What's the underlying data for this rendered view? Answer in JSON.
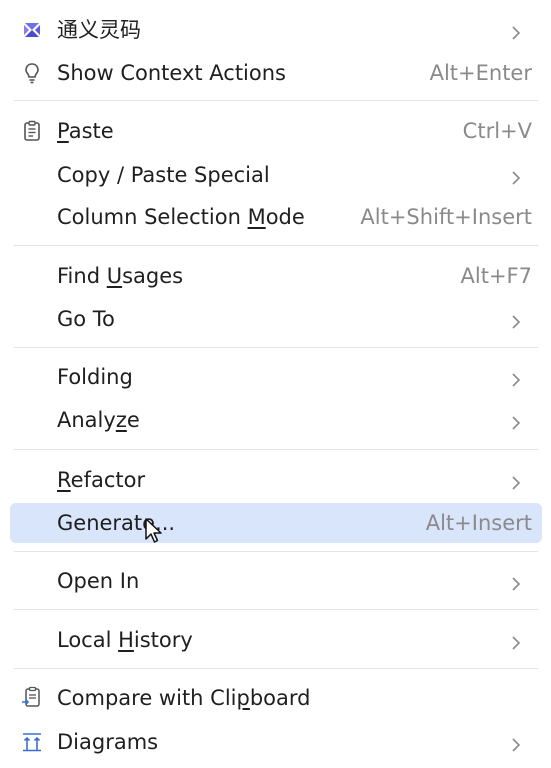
{
  "menu": {
    "items": [
      {
        "label": "通义灵码",
        "shortcut": "",
        "submenu": true,
        "icon": "tongyi-icon"
      },
      {
        "label": "Show Context Actions",
        "shortcut": "Alt+Enter",
        "submenu": false,
        "icon": "bulb-icon"
      },
      {
        "label_pre": "",
        "label_mn": "P",
        "label_post": "aste",
        "shortcut": "Ctrl+V",
        "submenu": false,
        "icon": "clipboard-icon"
      },
      {
        "label": "Copy / Paste Special",
        "shortcut": "",
        "submenu": true
      },
      {
        "label_pre": "Column Selection ",
        "label_mn": "M",
        "label_post": "ode",
        "shortcut": "Alt+Shift+Insert",
        "submenu": false
      },
      {
        "label_pre": "Find ",
        "label_mn": "U",
        "label_post": "sages",
        "shortcut": "Alt+F7",
        "submenu": false
      },
      {
        "label": "Go To",
        "shortcut": "",
        "submenu": true
      },
      {
        "label": "Folding",
        "shortcut": "",
        "submenu": true
      },
      {
        "label_pre": "Analy",
        "label_mn": "z",
        "label_post": "e",
        "shortcut": "",
        "submenu": true
      },
      {
        "label_pre": "",
        "label_mn": "R",
        "label_post": "efactor",
        "shortcut": "",
        "submenu": true
      },
      {
        "label": "Generate...",
        "shortcut": "Alt+Insert",
        "submenu": false,
        "highlighted": true
      },
      {
        "label": "Open In",
        "shortcut": "",
        "submenu": true
      },
      {
        "label_pre": "Local ",
        "label_mn": "H",
        "label_post": "istory",
        "shortcut": "",
        "submenu": true
      },
      {
        "label_pre": "Compare with Cli",
        "label_mn": "p",
        "label_post": "board",
        "shortcut": "",
        "submenu": false,
        "icon": "compare-clipboard-icon"
      },
      {
        "label": "Diagrams",
        "shortcut": "",
        "submenu": true,
        "icon": "diagram-icon"
      }
    ]
  },
  "colors": {
    "highlight": "#d9e5fb",
    "text": "#1f1f1f",
    "shortcut": "#8a8a8a",
    "separator": "#e4e4e4",
    "accent": "#3b6fd8"
  }
}
